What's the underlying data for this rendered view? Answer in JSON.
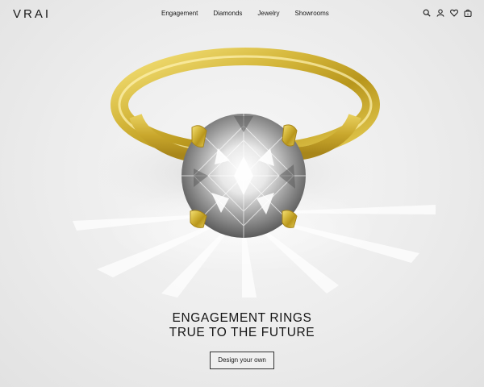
{
  "header": {
    "logo": "VRAI",
    "nav": [
      {
        "label": "Engagement"
      },
      {
        "label": "Diamonds"
      },
      {
        "label": "Jewelry"
      },
      {
        "label": "Showrooms"
      }
    ],
    "icons": [
      "search-icon",
      "account-icon",
      "heart-icon",
      "bag-icon"
    ]
  },
  "hero": {
    "headline_line1": "ENGAGEMENT RINGS",
    "headline_line2": "TRUE TO THE FUTURE",
    "cta_label": "Design your own"
  },
  "colors": {
    "background": "#ececec",
    "text": "#141414",
    "gold": "#d4b63a",
    "cta_border": "#333333"
  }
}
